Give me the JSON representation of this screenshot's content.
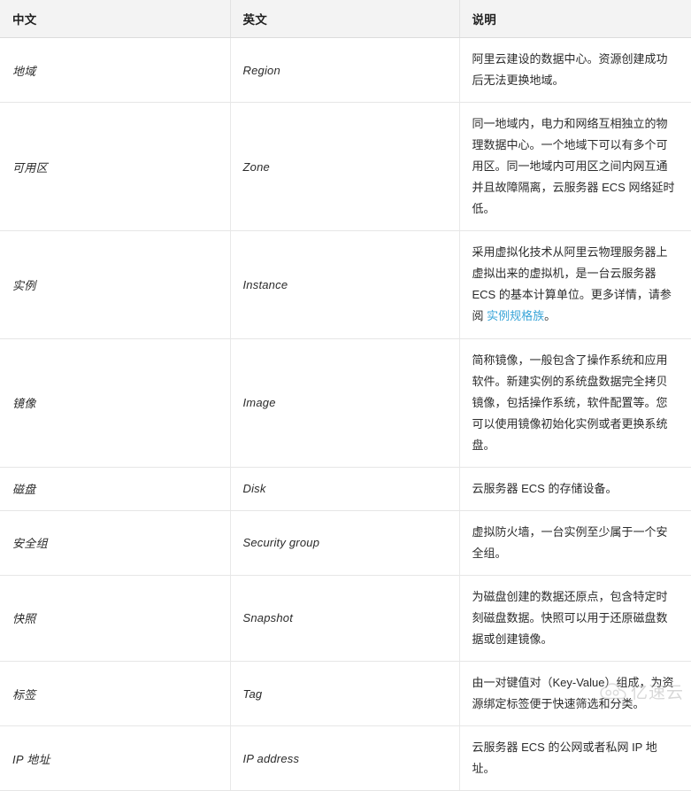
{
  "table": {
    "headers": {
      "chinese": "中文",
      "english": "英文",
      "description": "说明"
    },
    "rows": [
      {
        "cn": "地域",
        "en": "Region",
        "desc": "阿里云建设的数据中心。资源创建成功后无法更换地域。"
      },
      {
        "cn": "可用区",
        "en": "Zone",
        "desc": "同一地域内，电力和网络互相独立的物理数据中心。一个地域下可以有多个可用区。同一地域内可用区之间内网互通并且故障隔离，云服务器 ECS 网络延时低。"
      },
      {
        "cn": "实例",
        "en": "Instance",
        "desc_before": "采用虚拟化技术从阿里云物理服务器上虚拟出来的虚拟机，是一台云服务器 ECS 的基本计算单位。更多详情，请参阅 ",
        "desc_link": "实例规格族",
        "desc_after": "。"
      },
      {
        "cn": "镜像",
        "en": "Image",
        "desc": "简称镜像，一般包含了操作系统和应用软件。新建实例的系统盘数据完全拷贝镜像，包括操作系统，软件配置等。您可以使用镜像初始化实例或者更换系统盘。"
      },
      {
        "cn": "磁盘",
        "en": "Disk",
        "desc": "云服务器 ECS 的存储设备。"
      },
      {
        "cn": "安全组",
        "en": "Security group",
        "desc": "虚拟防火墙，一台实例至少属于一个安全组。"
      },
      {
        "cn": "快照",
        "en": "Snapshot",
        "desc": "为磁盘创建的数据还原点，包含特定时刻磁盘数据。快照可以用于还原磁盘数据或创建镜像。"
      },
      {
        "cn": "标签",
        "en": "Tag",
        "desc": "由一对键值对（Key-Value）组成，为资源绑定标签便于快速筛选和分类。"
      },
      {
        "cn": "IP 地址",
        "en": "IP address",
        "desc": "云服务器 ECS 的公网或者私网 IP 地址。"
      }
    ]
  },
  "watermark": {
    "text": "亿速云",
    "icon": "cloud-icon"
  },
  "colors": {
    "header_bg": "#f3f3f3",
    "link": "#3aa5d8",
    "border": "#e6e6e6",
    "text": "#333333"
  }
}
